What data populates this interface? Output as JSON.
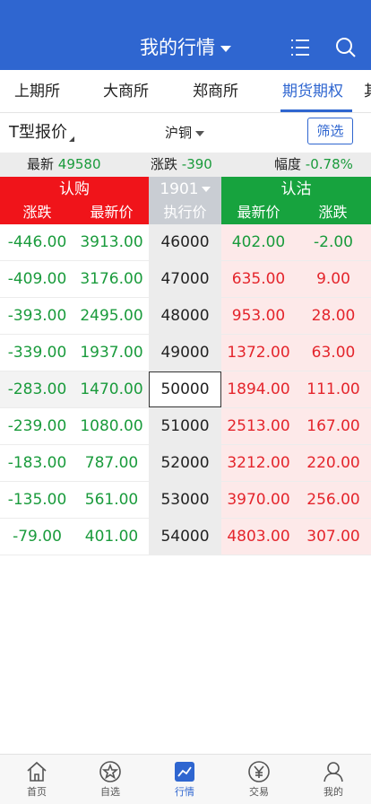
{
  "header": {
    "title": "我的行情"
  },
  "tabs": [
    {
      "label": "上期所"
    },
    {
      "label": "大商所"
    },
    {
      "label": "郑商所"
    },
    {
      "label": "期货期权"
    }
  ],
  "tab_overflow": "其",
  "toolbar": {
    "quote_type": "T型报价",
    "contract": "沪铜",
    "filter_label": "筛选"
  },
  "summary": {
    "last_label": "最新",
    "last_value": "49580",
    "change_label": "涨跌",
    "change_value": "-390",
    "range_label": "幅度",
    "range_value": "-0.78%"
  },
  "columns": {
    "call_title": "认购",
    "put_title": "认沽",
    "month": "1901",
    "strike_label": "执行价",
    "change_label": "涨跌",
    "last_label": "最新价"
  },
  "rows": [
    {
      "call_change": "-446.00",
      "call_last": "3913.00",
      "strike": "46000",
      "put_last": "402.00",
      "put_change": "-2.00",
      "put_last_color": "green",
      "put_change_color": "green"
    },
    {
      "call_change": "-409.00",
      "call_last": "3176.00",
      "strike": "47000",
      "put_last": "635.00",
      "put_change": "9.00",
      "put_last_color": "red",
      "put_change_color": "red"
    },
    {
      "call_change": "-393.00",
      "call_last": "2495.00",
      "strike": "48000",
      "put_last": "953.00",
      "put_change": "28.00",
      "put_last_color": "red",
      "put_change_color": "red"
    },
    {
      "call_change": "-339.00",
      "call_last": "1937.00",
      "strike": "49000",
      "put_last": "1372.00",
      "put_change": "63.00",
      "put_last_color": "red",
      "put_change_color": "red"
    },
    {
      "call_change": "-283.00",
      "call_last": "1470.00",
      "strike": "50000",
      "put_last": "1894.00",
      "put_change": "111.00",
      "put_last_color": "red",
      "put_change_color": "red",
      "atm": true
    },
    {
      "call_change": "-239.00",
      "call_last": "1080.00",
      "strike": "51000",
      "put_last": "2513.00",
      "put_change": "167.00",
      "put_last_color": "red",
      "put_change_color": "red"
    },
    {
      "call_change": "-183.00",
      "call_last": "787.00",
      "strike": "52000",
      "put_last": "3212.00",
      "put_change": "220.00",
      "put_last_color": "red",
      "put_change_color": "red"
    },
    {
      "call_change": "-135.00",
      "call_last": "561.00",
      "strike": "53000",
      "put_last": "3970.00",
      "put_change": "256.00",
      "put_last_color": "red",
      "put_change_color": "red"
    },
    {
      "call_change": "-79.00",
      "call_last": "401.00",
      "strike": "54000",
      "put_last": "4803.00",
      "put_change": "307.00",
      "put_last_color": "red",
      "put_change_color": "red"
    }
  ],
  "bottom_nav": [
    {
      "label": "首页",
      "icon": "home-icon"
    },
    {
      "label": "自选",
      "icon": "star-icon"
    },
    {
      "label": "行情",
      "icon": "chart-icon",
      "active": true
    },
    {
      "label": "交易",
      "icon": "yen-icon"
    },
    {
      "label": "我的",
      "icon": "user-icon"
    }
  ],
  "colors": {
    "brand_blue": "#2f66d0",
    "call_red": "#f0141a",
    "put_green": "#17a33e",
    "up_red": "#e4252c",
    "down_green": "#1a9b3c"
  }
}
